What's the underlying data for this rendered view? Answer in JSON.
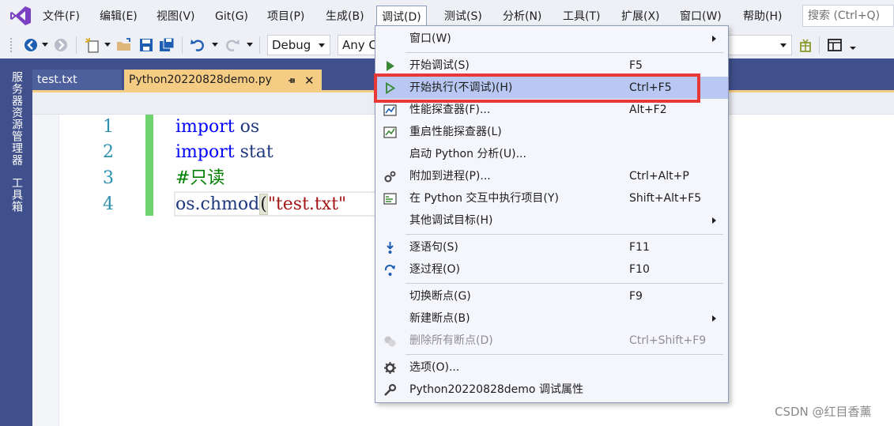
{
  "menubar": {
    "items": [
      "文件(F)",
      "编辑(E)",
      "视图(V)",
      "Git(G)",
      "项目(P)",
      "生成(B)",
      "调试(D)",
      "测试(S)",
      "分析(N)",
      "工具(T)",
      "扩展(X)",
      "窗口(W)",
      "帮助(H)"
    ],
    "active_index": 6,
    "search_placeholder": "搜索 (Ctrl+Q)"
  },
  "toolbar": {
    "config_combo": "Debug",
    "platform_combo": "Any C"
  },
  "side_tabs": [
    "服务器资源管理器",
    "工具箱"
  ],
  "doc_tabs": [
    {
      "label": "test.txt",
      "active": false
    },
    {
      "label": "Python20220828demo.py",
      "active": true
    }
  ],
  "editor": {
    "line_numbers": [
      "1",
      "2",
      "3",
      "4"
    ],
    "lines": [
      {
        "kw": "import",
        "rest": " os"
      },
      {
        "kw": "import",
        "rest": " stat"
      },
      {
        "comment": "#只读"
      },
      {
        "obj": "os.chmod",
        "paren": "(",
        "str": "\"test.txt\""
      }
    ]
  },
  "debug_menu": {
    "items": [
      {
        "label": "窗口(W)",
        "shortcut": "",
        "icon": "",
        "submenu": true,
        "disabled": false
      },
      {
        "label": "开始调试(S)",
        "shortcut": "F5",
        "icon": "play-solid-icon",
        "submenu": false,
        "disabled": false
      },
      {
        "label": "开始执行(不调试)(H)",
        "shortcut": "Ctrl+F5",
        "icon": "play-outline-icon",
        "submenu": false,
        "disabled": false,
        "highlighted": true
      },
      {
        "label": "性能探查器(F)...",
        "shortcut": "Alt+F2",
        "icon": "profiler-icon",
        "submenu": false,
        "disabled": false
      },
      {
        "label": "重启性能探查器(L)",
        "shortcut": "",
        "icon": "profiler-restart-icon",
        "submenu": false,
        "disabled": false
      },
      {
        "label": "启动 Python 分析(U)...",
        "shortcut": "",
        "icon": "",
        "submenu": false,
        "disabled": false
      },
      {
        "label": "附加到进程(P)...",
        "shortcut": "Ctrl+Alt+P",
        "icon": "attach-process-icon",
        "submenu": false,
        "disabled": false
      },
      {
        "label": "在 Python 交互中执行项目(Y)",
        "shortcut": "Shift+Alt+F5",
        "icon": "interactive-window-icon",
        "submenu": false,
        "disabled": false
      },
      {
        "label": "其他调试目标(H)",
        "shortcut": "",
        "icon": "",
        "submenu": true,
        "disabled": false
      },
      {
        "label": "逐语句(S)",
        "shortcut": "F11",
        "icon": "step-into-icon",
        "submenu": false,
        "disabled": false
      },
      {
        "label": "逐过程(O)",
        "shortcut": "F10",
        "icon": "step-over-icon",
        "submenu": false,
        "disabled": false
      },
      {
        "label": "切换断点(G)",
        "shortcut": "F9",
        "icon": "",
        "submenu": false,
        "disabled": false
      },
      {
        "label": "新建断点(B)",
        "shortcut": "",
        "icon": "",
        "submenu": true,
        "disabled": false
      },
      {
        "label": "删除所有断点(D)",
        "shortcut": "Ctrl+Shift+F9",
        "icon": "delete-breakpoints-icon",
        "submenu": false,
        "disabled": true
      },
      {
        "label": "选项(O)...",
        "shortcut": "",
        "icon": "gear-icon",
        "submenu": false,
        "disabled": false
      },
      {
        "label": "Python20220828demo 调试属性",
        "shortcut": "",
        "icon": "wrench-icon",
        "submenu": false,
        "disabled": false
      }
    ]
  },
  "watermark": "CSDN @红目香薰",
  "colors": {
    "accent": "#40508d",
    "active_tab": "#f5cc84",
    "highlight": "#b8c8f3",
    "annotation": "#e83737"
  }
}
